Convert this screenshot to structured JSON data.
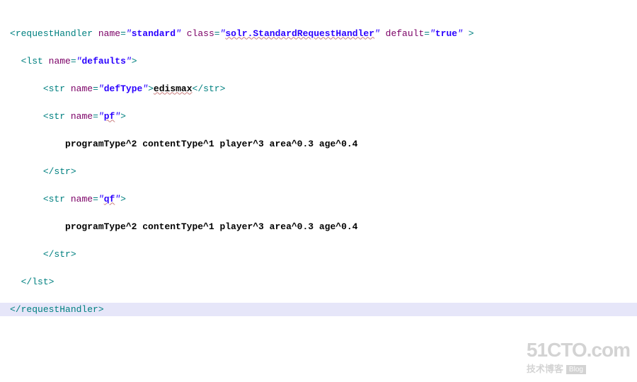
{
  "xml": {
    "requestHandler": {
      "tagOpen": "requestHandler",
      "attrs": {
        "nameKey": "name",
        "nameVal": "standard",
        "classKey": "class",
        "classVal": "solr.StandardRequestHandler",
        "defaultKey": "default",
        "defaultVal": "true"
      },
      "tagClose": "/requestHandler"
    },
    "lst": {
      "tagOpen": "lst",
      "attrs": {
        "nameKey": "name",
        "nameVal": "defaults"
      },
      "tagClose": "/lst"
    },
    "str1": {
      "tagOpen": "str",
      "attrs": {
        "nameKey": "name",
        "nameVal": "defType"
      },
      "content": "edismax",
      "tagClose": "/str"
    },
    "str2": {
      "tagOpen": "str",
      "attrs": {
        "nameKey": "name",
        "nameVal": "pf"
      },
      "content": "programType^2 contentType^1 player^3 area^0.3 age^0.4",
      "tagClose": "/str"
    },
    "str3": {
      "tagOpen": "str",
      "attrs": {
        "nameKey": "name",
        "nameVal": "qf"
      },
      "content": "programType^2 contentType^1 player^3 area^0.3 age^0.4",
      "tagClose": "/str"
    }
  },
  "watermark": {
    "site": "51CTO.com",
    "subtitle": "技术博客",
    "badge": "Blog"
  }
}
